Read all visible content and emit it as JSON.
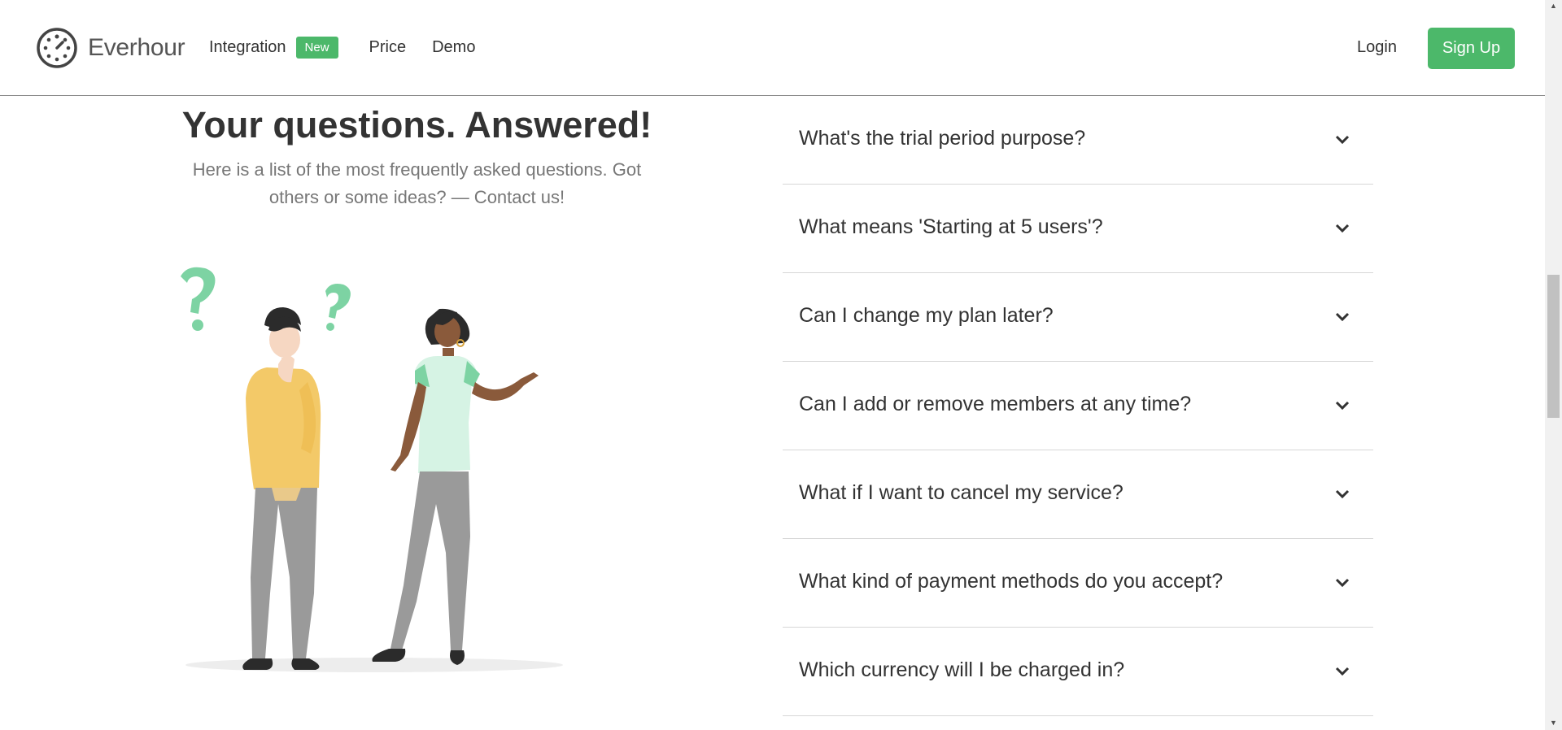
{
  "header": {
    "brand": "Everhour",
    "nav": {
      "integration": "Integration",
      "new_badge": "New",
      "price": "Price",
      "demo": "Demo"
    },
    "login": "Login",
    "signup": "Sign Up"
  },
  "hero": {
    "title": "Your questions. Answered!",
    "subtitle": "Here is a list of the most frequently asked questions. Got others or some ideas? — Contact us!"
  },
  "faq": [
    {
      "question": "What's the trial period purpose?"
    },
    {
      "question": "What means 'Starting at 5 users'?"
    },
    {
      "question": "Can I change my plan later?"
    },
    {
      "question": "Can I add or remove members at any time?"
    },
    {
      "question": "What if I want to cancel my service?"
    },
    {
      "question": "What kind of payment methods do you accept?"
    },
    {
      "question": "Which currency will I be charged in?"
    }
  ],
  "colors": {
    "accent": "#4cb86a",
    "text": "#333333",
    "muted": "#777777",
    "divider": "#d6d6d6"
  },
  "icons": [
    "clock-logo-icon",
    "chevron-down-icon",
    "people-illustration"
  ]
}
